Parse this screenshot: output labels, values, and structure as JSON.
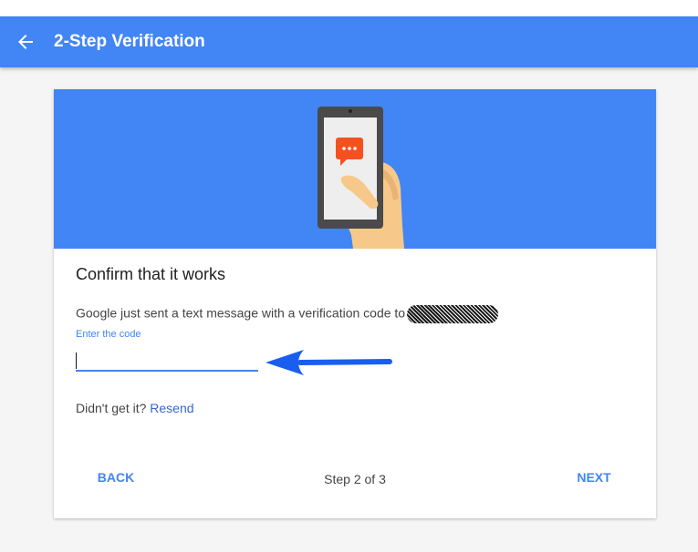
{
  "app_bar": {
    "title": "2-Step Verification",
    "back_icon": "arrow-back-icon",
    "color": "#4285f4"
  },
  "hero": {
    "illustration": "phone-in-hand-with-message-icon",
    "background_color": "#4285f4",
    "message_bubble_color": "#f4511e"
  },
  "card": {
    "title": "Confirm that it works",
    "description": "Google just sent a text message with a verification code to",
    "phone_number_redacted": true
  },
  "code_field": {
    "label": "Enter the code",
    "value": "",
    "accent_color": "#4285f4"
  },
  "annotation": {
    "arrow_color": "#1a5ef0",
    "icon": "arrow-left-icon"
  },
  "resend": {
    "prompt": "Didn't get it?",
    "link_label": "Resend"
  },
  "footer": {
    "back_label": "BACK",
    "step_label": "Step 2 of 3",
    "next_label": "NEXT"
  }
}
